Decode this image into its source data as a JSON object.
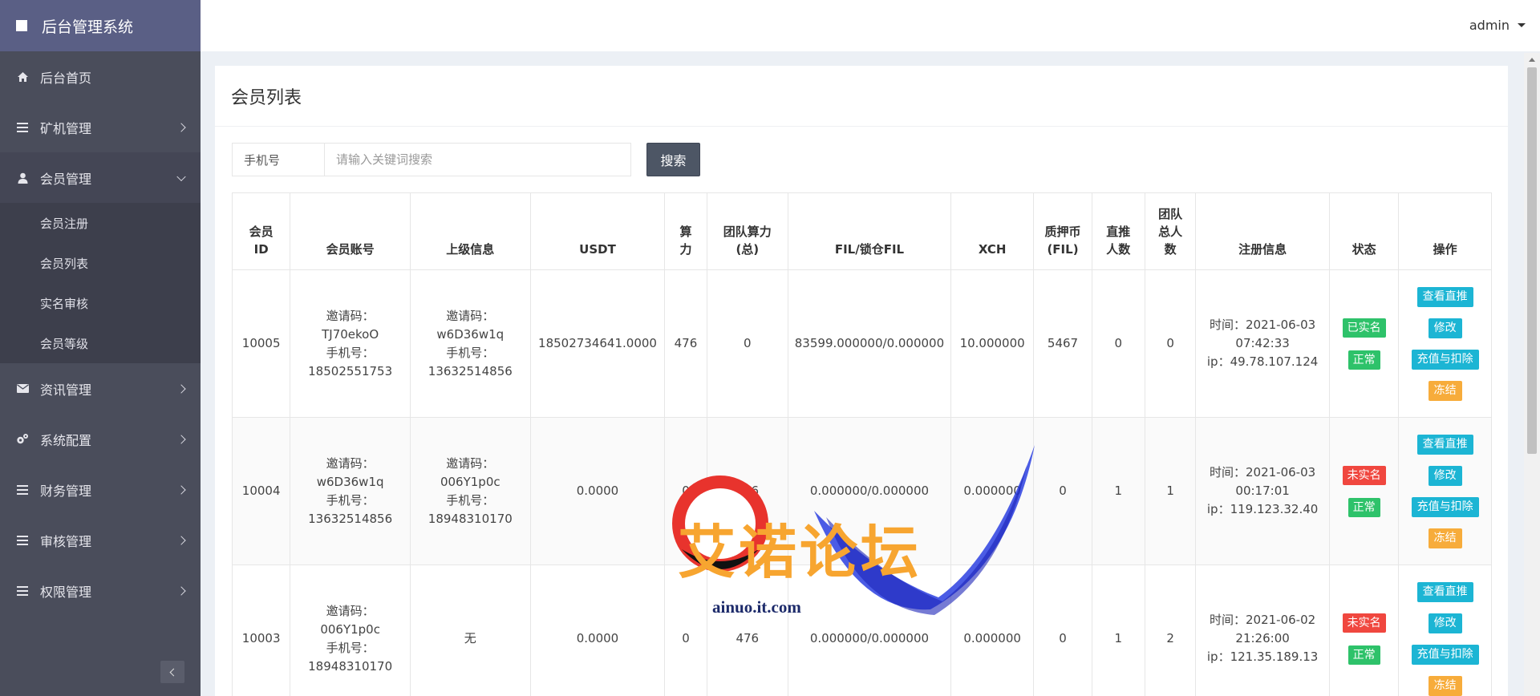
{
  "app": {
    "title": "后台管理系统"
  },
  "sidebar": {
    "items": [
      {
        "label": "后台首页",
        "icon": "home-icon"
      },
      {
        "label": "矿机管理",
        "icon": "list-icon"
      },
      {
        "label": "会员管理",
        "icon": "user-icon",
        "open": true
      },
      {
        "label": "资讯管理",
        "icon": "envelope-icon"
      },
      {
        "label": "系统配置",
        "icon": "gears-icon"
      },
      {
        "label": "财务管理",
        "icon": "list-icon"
      },
      {
        "label": "审核管理",
        "icon": "list-icon"
      },
      {
        "label": "权限管理",
        "icon": "list-icon"
      }
    ],
    "submenu": [
      "会员注册",
      "会员列表",
      "实名审核",
      "会员等级"
    ]
  },
  "topbar": {
    "user": "admin"
  },
  "panel": {
    "title": "会员列表"
  },
  "search": {
    "label": "手机号",
    "placeholder": "请输入关键词搜索",
    "button": "搜索"
  },
  "table": {
    "headers": [
      "会员ID",
      "会员账号",
      "上级信息",
      "USDT",
      "算力",
      "团队算力(总)",
      "FIL/锁仓FIL",
      "XCH",
      "质押币(FIL)",
      "直推人数",
      "团队总人数",
      "注册信息",
      "状态",
      "操作"
    ],
    "rows": [
      {
        "id": "10005",
        "account": [
          "邀请码：",
          "TJ70ekoO",
          "手机号：",
          "18502551753"
        ],
        "parent": [
          "邀请码：",
          "w6D36w1q",
          "手机号：",
          "13632514856"
        ],
        "usdt": "18502734641.0000",
        "power": "476",
        "team_power": "0",
        "fil": "83599.000000/0.000000",
        "xch": "10.000000",
        "pledge": "5467",
        "direct": "0",
        "team_total": "0",
        "reg": [
          "时间：2021-06-03",
          "07:42:33",
          "ip：49.78.107.124"
        ],
        "verify": "已实名",
        "state": "正常"
      },
      {
        "id": "10004",
        "account": [
          "邀请码：",
          "w6D36w1q",
          "手机号：",
          "13632514856"
        ],
        "parent": [
          "邀请码：",
          "006Y1p0c",
          "手机号：",
          "18948310170"
        ],
        "usdt": "0.0000",
        "power": "0",
        "team_power": "476",
        "fil": "0.000000/0.000000",
        "xch": "0.000000",
        "pledge": "0",
        "direct": "1",
        "team_total": "1",
        "reg": [
          "时间：2021-06-03",
          "00:17:01",
          "ip：119.123.32.40"
        ],
        "verify": "未实名",
        "state": "正常"
      },
      {
        "id": "10003",
        "account": [
          "邀请码：",
          "006Y1p0c",
          "手机号：",
          "18948310170"
        ],
        "parent": [
          "无"
        ],
        "usdt": "0.0000",
        "power": "0",
        "team_power": "476",
        "fil": "0.000000/0.000000",
        "xch": "0.000000",
        "pledge": "0",
        "direct": "1",
        "team_total": "2",
        "reg": [
          "时间：2021-06-02",
          "21:26:00",
          "ip：121.35.189.13"
        ],
        "verify": "未实名",
        "state": "正常"
      }
    ],
    "actions": [
      "查看直推",
      "修改",
      "充值与扣除",
      "冻结"
    ]
  },
  "watermark": {
    "text": "艾诺论坛",
    "sub": "ainuo.it.com"
  },
  "colors": {
    "sidebar": "#4a4d5b",
    "brand": "#5a5f85",
    "search_button": "#4d5665",
    "green": "#2ec26a",
    "red": "#f0473f",
    "cyan": "#1cb5d4",
    "orange": "#f7ac3b"
  }
}
